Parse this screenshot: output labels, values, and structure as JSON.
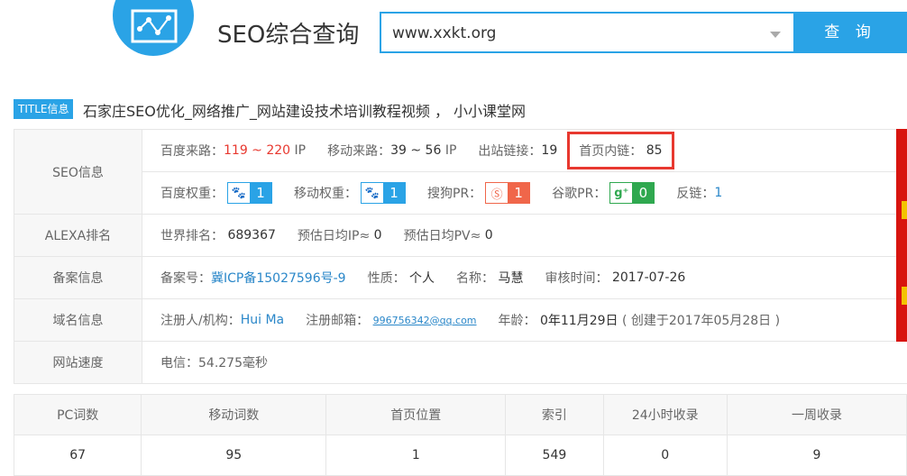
{
  "header": {
    "app_title": "SEO综合查询",
    "search_value": "www.xxkt.org",
    "search_button": "查 询"
  },
  "title_info": {
    "badge": "TITLE信息",
    "text": "石家庄SEO优化_网络推广_网站建设技术培训教程视频 ， 小小课堂网"
  },
  "seo": {
    "label": "SEO信息",
    "baidu_traffic_label": "百度来路：",
    "baidu_traffic_value": "119 ~ 220",
    "baidu_traffic_unit": "IP",
    "mobile_traffic_label": "移动来路：",
    "mobile_traffic_value": "39 ~ 56",
    "mobile_traffic_unit": "IP",
    "outbound_label": "出站链接：",
    "outbound_value": "19",
    "internal_label": "首页内链：",
    "internal_value": "85",
    "baidu_weight_label": "百度权重：",
    "baidu_weight_value": "1",
    "mobile_weight_label": "移动权重：",
    "mobile_weight_value": "1",
    "sogou_label": "搜狗PR：",
    "sogou_value": "1",
    "google_label": "谷歌PR：",
    "google_value": "0",
    "backlink_label": "反链：",
    "backlink_value": "1"
  },
  "alexa": {
    "label": "ALEXA排名",
    "world_label": "世界排名：",
    "world_value": "689367",
    "ip_label": "预估日均IP≈",
    "ip_value": "0",
    "pv_label": "预估日均PV≈",
    "pv_value": "0"
  },
  "icp": {
    "label": "备案信息",
    "no_label": "备案号：",
    "no_value": "冀ICP备15027596号-9",
    "nature_label": "性质：",
    "nature_value": "个人",
    "name_label": "名称：",
    "name_value": "马慧",
    "date_label": "审核时间：",
    "date_value": "2017-07-26"
  },
  "domain": {
    "label": "域名信息",
    "registrant_label": "注册人/机构：",
    "registrant_value": "Hui Ma",
    "email_label": "注册邮箱：",
    "email_value": "996756342@qq.com",
    "age_label": "年龄：",
    "age_value": "0年11月29日",
    "created_value": "( 创建于2017年05月28日 )"
  },
  "speed": {
    "label": "网站速度",
    "value": "电信：54.275毫秒"
  },
  "stats": {
    "headers": [
      "PC词数",
      "移动词数",
      "首页位置",
      "索引",
      "24小时收录",
      "一周收录"
    ],
    "values": [
      "67",
      "95",
      "1",
      "549",
      "0",
      "9"
    ]
  },
  "colors": {
    "accent": "#2aa3e6",
    "red": "#e8382f",
    "green": "#2fa84f",
    "sogou": "#f0664a"
  }
}
